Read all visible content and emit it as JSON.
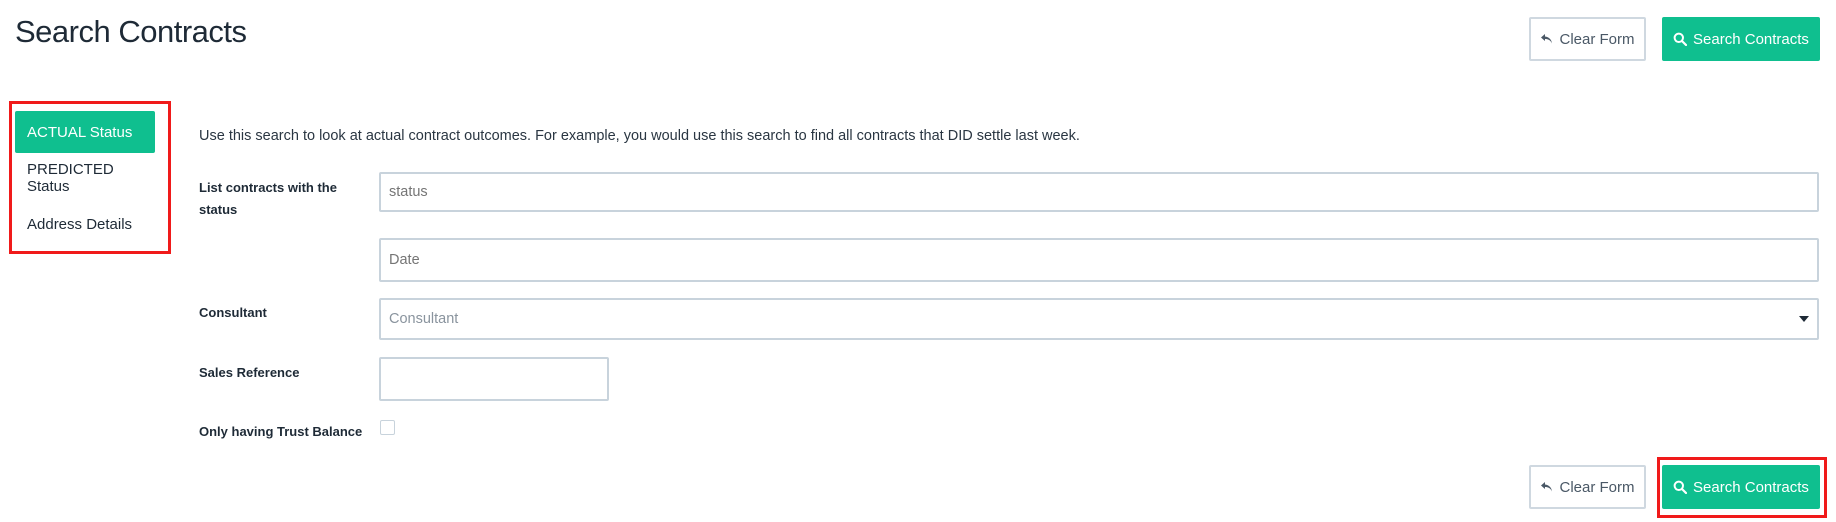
{
  "header": {
    "title": "Search Contracts",
    "clear_label": "Clear Form",
    "search_label": "Search Contracts"
  },
  "sidebar": {
    "items": [
      {
        "label": "ACTUAL Status",
        "active": true
      },
      {
        "label": "PREDICTED Status",
        "active": false
      },
      {
        "label": "Address Details",
        "active": false
      }
    ]
  },
  "main": {
    "intro": "Use this search to look at actual contract outcomes. For example, you would use this search to find all contracts that DID settle last week.",
    "status_label": "List contracts with the status",
    "status_placeholder": "status",
    "date_placeholder": "Date",
    "consultant_label": "Consultant",
    "consultant_placeholder": "Consultant",
    "sales_reference_label": "Sales Reference",
    "sales_reference_value": "",
    "trust_balance_label": "Only having Trust Balance",
    "trust_balance_checked": false
  },
  "footer": {
    "clear_label": "Clear Form",
    "search_label": "Search Contracts"
  },
  "colors": {
    "accent": "#0fbf8f",
    "highlight": "#f01a1a"
  },
  "icons": {
    "clear": "undo-arrow-icon",
    "search": "search-icon",
    "dropdown": "caret-down-icon"
  }
}
